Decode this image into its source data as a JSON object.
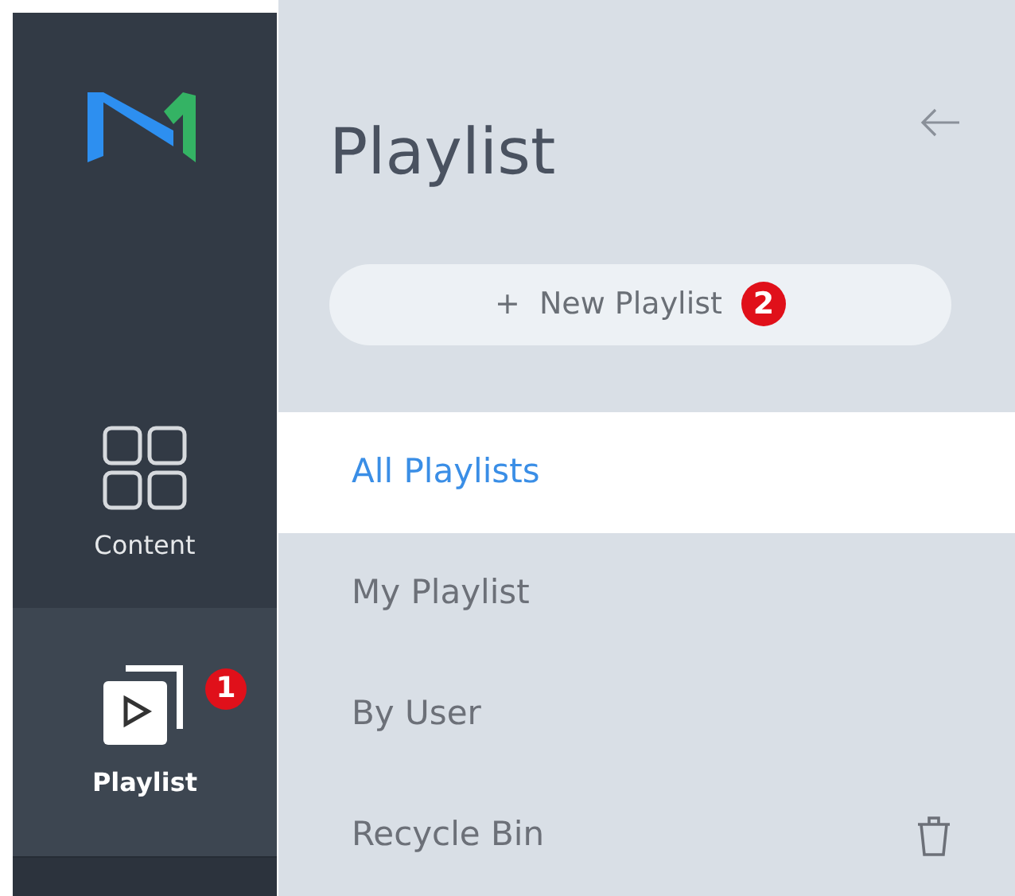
{
  "sidebar": {
    "items": [
      {
        "label": "Content",
        "kind": "grid",
        "selected": false
      },
      {
        "label": "Playlist",
        "kind": "playlist",
        "selected": true,
        "badge": "1"
      }
    ]
  },
  "panel": {
    "title": "Playlist",
    "new_button": {
      "label": "New Playlist",
      "icon": "+",
      "badge": "2"
    },
    "menu": [
      {
        "label": "All Playlists",
        "selected": true
      },
      {
        "label": "My Playlist",
        "selected": false
      },
      {
        "label": "By User",
        "selected": false
      },
      {
        "label": "Recycle Bin",
        "selected": false,
        "kind": "trash"
      }
    ]
  }
}
